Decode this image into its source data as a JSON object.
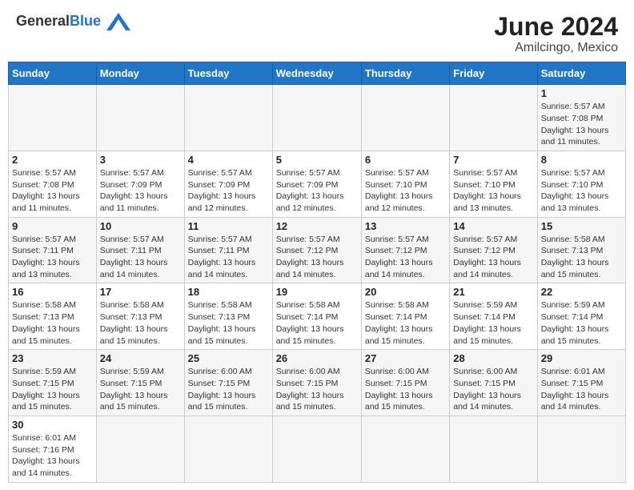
{
  "logo": {
    "text_general": "General",
    "text_blue": "Blue"
  },
  "title": "June 2024",
  "subtitle": "Amilcingo, Mexico",
  "weekdays": [
    "Sunday",
    "Monday",
    "Tuesday",
    "Wednesday",
    "Thursday",
    "Friday",
    "Saturday"
  ],
  "weeks": [
    [
      {
        "day": "",
        "info": ""
      },
      {
        "day": "",
        "info": ""
      },
      {
        "day": "",
        "info": ""
      },
      {
        "day": "",
        "info": ""
      },
      {
        "day": "",
        "info": ""
      },
      {
        "day": "",
        "info": ""
      },
      {
        "day": "1",
        "info": "Sunrise: 5:57 AM\nSunset: 7:08 PM\nDaylight: 13 hours and 11 minutes."
      }
    ],
    [
      {
        "day": "2",
        "info": "Sunrise: 5:57 AM\nSunset: 7:08 PM\nDaylight: 13 hours and 11 minutes."
      },
      {
        "day": "3",
        "info": "Sunrise: 5:57 AM\nSunset: 7:09 PM\nDaylight: 13 hours and 11 minutes."
      },
      {
        "day": "4",
        "info": "Sunrise: 5:57 AM\nSunset: 7:09 PM\nDaylight: 13 hours and 12 minutes."
      },
      {
        "day": "5",
        "info": "Sunrise: 5:57 AM\nSunset: 7:09 PM\nDaylight: 13 hours and 12 minutes."
      },
      {
        "day": "6",
        "info": "Sunrise: 5:57 AM\nSunset: 7:10 PM\nDaylight: 13 hours and 12 minutes."
      },
      {
        "day": "7",
        "info": "Sunrise: 5:57 AM\nSunset: 7:10 PM\nDaylight: 13 hours and 13 minutes."
      },
      {
        "day": "8",
        "info": "Sunrise: 5:57 AM\nSunset: 7:10 PM\nDaylight: 13 hours and 13 minutes."
      }
    ],
    [
      {
        "day": "9",
        "info": "Sunrise: 5:57 AM\nSunset: 7:11 PM\nDaylight: 13 hours and 13 minutes."
      },
      {
        "day": "10",
        "info": "Sunrise: 5:57 AM\nSunset: 7:11 PM\nDaylight: 13 hours and 14 minutes."
      },
      {
        "day": "11",
        "info": "Sunrise: 5:57 AM\nSunset: 7:11 PM\nDaylight: 13 hours and 14 minutes."
      },
      {
        "day": "12",
        "info": "Sunrise: 5:57 AM\nSunset: 7:12 PM\nDaylight: 13 hours and 14 minutes."
      },
      {
        "day": "13",
        "info": "Sunrise: 5:57 AM\nSunset: 7:12 PM\nDaylight: 13 hours and 14 minutes."
      },
      {
        "day": "14",
        "info": "Sunrise: 5:57 AM\nSunset: 7:12 PM\nDaylight: 13 hours and 14 minutes."
      },
      {
        "day": "15",
        "info": "Sunrise: 5:58 AM\nSunset: 7:13 PM\nDaylight: 13 hours and 15 minutes."
      }
    ],
    [
      {
        "day": "16",
        "info": "Sunrise: 5:58 AM\nSunset: 7:13 PM\nDaylight: 13 hours and 15 minutes."
      },
      {
        "day": "17",
        "info": "Sunrise: 5:58 AM\nSunset: 7:13 PM\nDaylight: 13 hours and 15 minutes."
      },
      {
        "day": "18",
        "info": "Sunrise: 5:58 AM\nSunset: 7:13 PM\nDaylight: 13 hours and 15 minutes."
      },
      {
        "day": "19",
        "info": "Sunrise: 5:58 AM\nSunset: 7:14 PM\nDaylight: 13 hours and 15 minutes."
      },
      {
        "day": "20",
        "info": "Sunrise: 5:58 AM\nSunset: 7:14 PM\nDaylight: 13 hours and 15 minutes."
      },
      {
        "day": "21",
        "info": "Sunrise: 5:59 AM\nSunset: 7:14 PM\nDaylight: 13 hours and 15 minutes."
      },
      {
        "day": "22",
        "info": "Sunrise: 5:59 AM\nSunset: 7:14 PM\nDaylight: 13 hours and 15 minutes."
      }
    ],
    [
      {
        "day": "23",
        "info": "Sunrise: 5:59 AM\nSunset: 7:15 PM\nDaylight: 13 hours and 15 minutes."
      },
      {
        "day": "24",
        "info": "Sunrise: 5:59 AM\nSunset: 7:15 PM\nDaylight: 13 hours and 15 minutes."
      },
      {
        "day": "25",
        "info": "Sunrise: 6:00 AM\nSunset: 7:15 PM\nDaylight: 13 hours and 15 minutes."
      },
      {
        "day": "26",
        "info": "Sunrise: 6:00 AM\nSunset: 7:15 PM\nDaylight: 13 hours and 15 minutes."
      },
      {
        "day": "27",
        "info": "Sunrise: 6:00 AM\nSunset: 7:15 PM\nDaylight: 13 hours and 15 minutes."
      },
      {
        "day": "28",
        "info": "Sunrise: 6:00 AM\nSunset: 7:15 PM\nDaylight: 13 hours and 14 minutes."
      },
      {
        "day": "29",
        "info": "Sunrise: 6:01 AM\nSunset: 7:15 PM\nDaylight: 13 hours and 14 minutes."
      }
    ],
    [
      {
        "day": "30",
        "info": "Sunrise: 6:01 AM\nSunset: 7:16 PM\nDaylight: 13 hours and 14 minutes."
      },
      {
        "day": "",
        "info": ""
      },
      {
        "day": "",
        "info": ""
      },
      {
        "day": "",
        "info": ""
      },
      {
        "day": "",
        "info": ""
      },
      {
        "day": "",
        "info": ""
      },
      {
        "day": "",
        "info": ""
      }
    ]
  ]
}
